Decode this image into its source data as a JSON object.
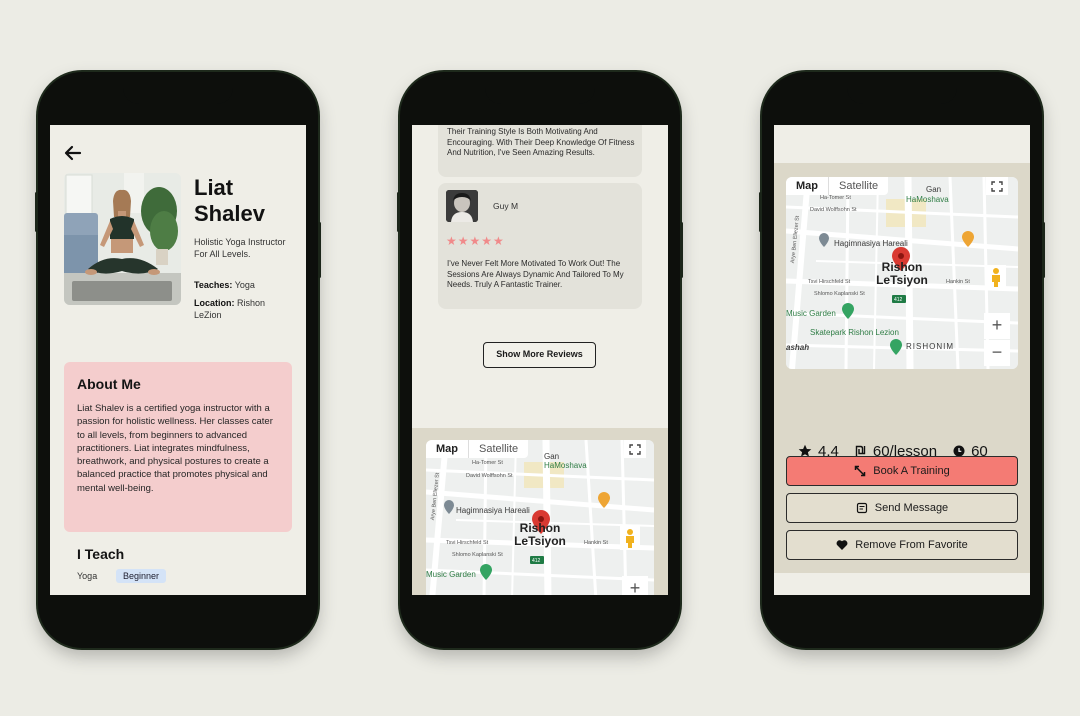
{
  "colors": {
    "background": "#ecece5",
    "phone_frame": "#0d0f0c",
    "screen": "#efeee7",
    "about_card": "#f4cdcd",
    "level_badge": "#d4e3f7",
    "review_card": "#e3e2da",
    "stars": "#f08a8a",
    "map_panel": "#dcd8c9",
    "primary_button": "#f47b74",
    "secondary_button": "#e3decf"
  },
  "profile": {
    "first_name": "Liat",
    "last_name": "Shalev",
    "subtitle": "Holistic Yoga Instructor For All Levels.",
    "teaches_label": "Teaches:",
    "teaches_value": "Yoga",
    "location_label": "Location:",
    "location_value": "Rishon LeZion",
    "about_title": "About Me",
    "about_body": "Liat Shalev is a certified yoga instructor with a passion for holistic wellness. Her classes cater to all levels, from beginners to advanced practitioners. Liat integrates mindfulness, breathwork, and physical postures to create a balanced practice that promotes physical and mental well-being.",
    "teach_title": "I Teach",
    "teach_sport": "Yoga",
    "teach_level": "Beginner"
  },
  "reviews": {
    "review1_text": "Their Training Style Is Both Motivating And Encouraging. With Their Deep Knowledge Of Fitness And Nutrition, I've Seen Amazing Results.",
    "review2_name": "Guy M",
    "review2_stars": "★★★★★",
    "review2_rating": 5,
    "review2_text": "I've Never Felt More Motivated To Work Out! The Sessions Are Always Dynamic And Tailored To My Needs. Truly A Fantastic Trainer.",
    "show_more_label": "Show More Reviews"
  },
  "map": {
    "tab_map": "Map",
    "tab_satellite": "Satellite",
    "city_line1": "Rishon",
    "city_line2": "LeTsiyon",
    "poi_gan": "Gan",
    "poi_hamoshava": "HaMoshava",
    "poi_hagimnasiya": "Hagimnasiya Hareali",
    "poi_music_garden": "Music Garden",
    "poi_skatepark": "Skatepark Rishon Lezion",
    "poi_rishonim": "RISHONIM",
    "poi_ashah": "ashah",
    "street_hatomer": "Ha-Tomer St",
    "street_david": "David Wolffsohn St",
    "street_tsvi": "Tsvi Hirschfeld St",
    "street_shlomo": "Shlomo Kaplanski St",
    "street_hankin": "Hankin St",
    "street_aryeh": "Arye Ben Eliezer St",
    "road_badge": "412",
    "zoom_in": "+",
    "zoom_out": "−"
  },
  "booking": {
    "rating": "4.4",
    "price": "60/lesson",
    "duration": "60",
    "book_label": "Book A Training",
    "message_label": "Send Message",
    "favorite_label": "Remove From Favorite"
  },
  "icons": {
    "back": "arrow-left-icon",
    "star": "star-icon",
    "currency": "shekel-icon",
    "clock": "clock-icon",
    "expand": "expand-arrows-icon",
    "message": "message-icon",
    "heart": "heart-icon",
    "pin": "map-pin-icon",
    "fullscreen": "fullscreen-icon",
    "pegman": "street-view-pegman-icon"
  }
}
